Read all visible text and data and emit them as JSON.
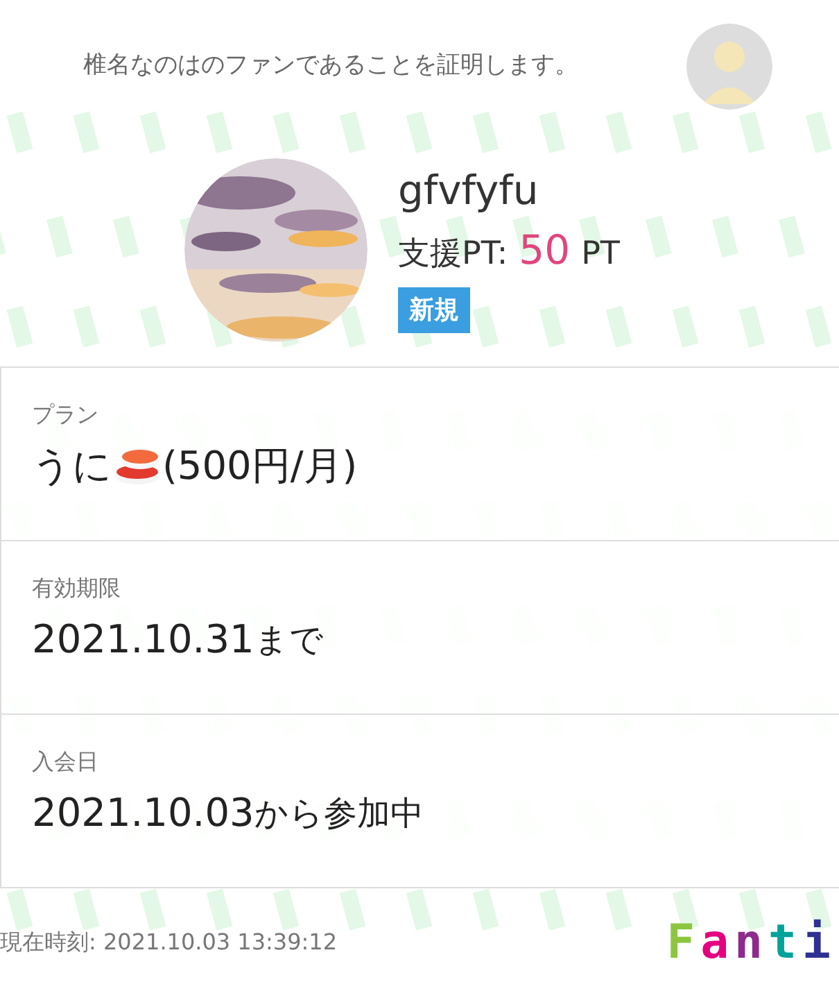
{
  "header": {
    "text": "椎名なのはのファンであることを証明します。"
  },
  "profile": {
    "name": "gfvfyfu",
    "points_label": "支援PT:",
    "points": "50",
    "points_unit": "PT",
    "badge": "新規"
  },
  "rows": [
    {
      "label": "プラン",
      "value": "うに",
      "suffix": "(500円/月)",
      "kind": "plan"
    },
    {
      "label": "有効期限",
      "value": "2021.10.31",
      "suffix": "まで",
      "kind": "date"
    },
    {
      "label": "入会日",
      "value": "2021.10.03",
      "suffix": "から参加中",
      "kind": "date"
    }
  ],
  "footer": {
    "time": "現在時刻: 2021.10.03 13:39:12",
    "logo": [
      {
        "char": "F",
        "color": "#8cc63f"
      },
      {
        "char": "a",
        "color": "#e4007f"
      },
      {
        "char": "n",
        "color": "#8e2a8e"
      },
      {
        "char": "t",
        "color": "#00a29a"
      },
      {
        "char": "i",
        "color": "#2e3192"
      }
    ]
  }
}
